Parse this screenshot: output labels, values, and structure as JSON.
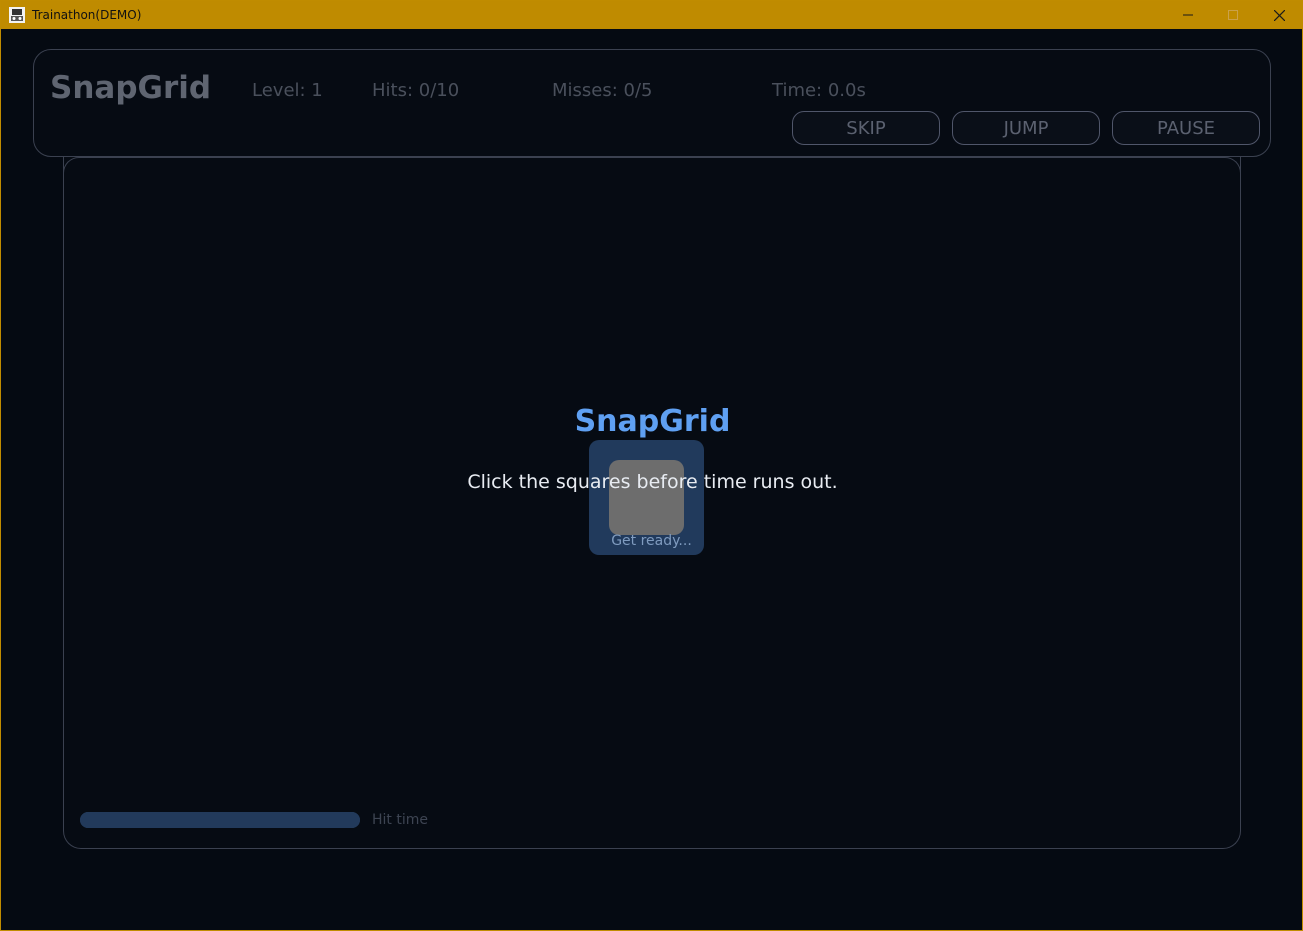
{
  "window": {
    "title": "Trainathon(DEMO)",
    "controls": [
      "minimize",
      "maximize",
      "close"
    ],
    "accent_color": "#bf8b00"
  },
  "header": {
    "game_title": "SnapGrid",
    "level_text": "Level: 1",
    "hits_text": "Hits: 0/10",
    "misses_text": "Misses: 0/5",
    "time_text": "Time: 0.0s",
    "buttons": {
      "skip": "SKIP",
      "jump": "JUMP",
      "pause": "PAUSE"
    }
  },
  "board": {
    "intro_title": "SnapGrid",
    "intro_text": "Click the squares before time runs out.",
    "ready_text": "Get ready...",
    "hit_time_label": "Hit time",
    "hit_time_fraction": 1.0,
    "colors": {
      "title": "#5fa0f2",
      "panel": "#213a5c",
      "square": "#6d6d6d"
    }
  }
}
